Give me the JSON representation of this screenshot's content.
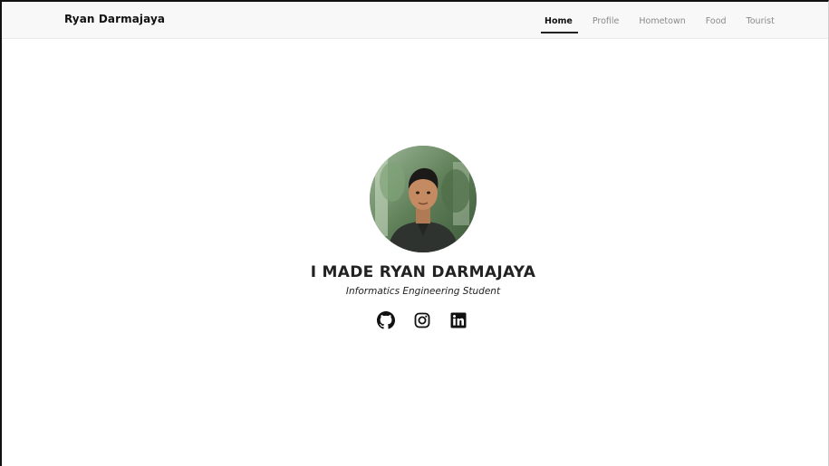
{
  "navbar": {
    "brand": "Ryan Darmajaya",
    "links": [
      {
        "label": "Home",
        "active": true
      },
      {
        "label": "Profile",
        "active": false
      },
      {
        "label": "Hometown",
        "active": false
      },
      {
        "label": "Food",
        "active": false
      },
      {
        "label": "Tourist",
        "active": false
      }
    ]
  },
  "hero": {
    "name": "I MADE RYAN DARMAJAYA",
    "subtitle": "Informatics Engineering Student",
    "socials": [
      {
        "icon": "github-icon"
      },
      {
        "icon": "instagram-icon"
      },
      {
        "icon": "linkedin-icon"
      }
    ]
  },
  "colors": {
    "navbar_bg": "#f8f8f8",
    "text_dark": "#222222",
    "nav_inactive": "#8a8a8a"
  }
}
